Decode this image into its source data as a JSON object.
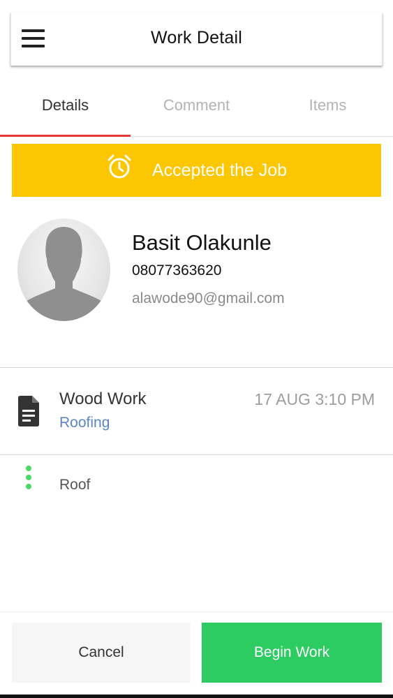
{
  "header": {
    "title": "Work Detail",
    "menu_icon": "menu-icon"
  },
  "tabs": [
    {
      "label": "Details",
      "active": true
    },
    {
      "label": "Comment",
      "active": false
    },
    {
      "label": "Items",
      "active": false
    }
  ],
  "colors": {
    "accent": "#e53935",
    "banner": "#fcc600",
    "primary_button": "#2dcc63",
    "link": "#5b86c5",
    "dots": "#4cd964"
  },
  "status": {
    "icon": "alarm-clock-icon",
    "text": "Accepted the Job"
  },
  "contact": {
    "avatar_icon": "person-placeholder-icon",
    "name": "Basit Olakunle",
    "phone": "08077363620",
    "email": "alawode90@gmail.com"
  },
  "job": {
    "icon": "document-icon",
    "title": "Wood Work",
    "category": "Roofing",
    "date": "17 AUG 3:10 PM"
  },
  "item": {
    "icon": "vertical-dots-icon",
    "label": "Roof"
  },
  "actions": {
    "cancel_label": "Cancel",
    "begin_label": "Begin Work"
  }
}
